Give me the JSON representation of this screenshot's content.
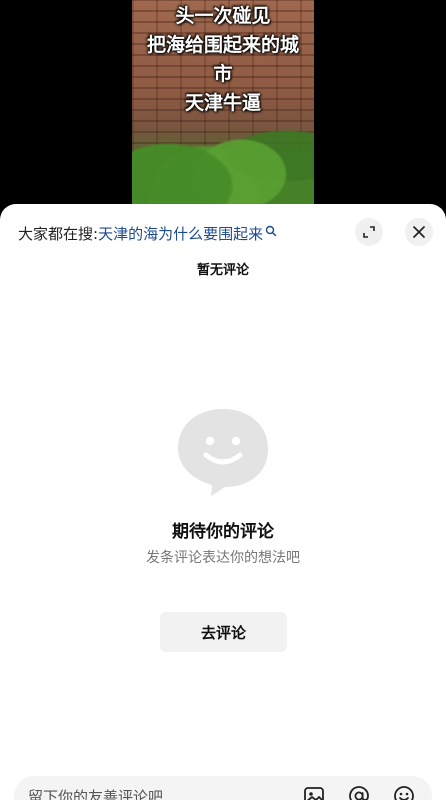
{
  "video": {
    "caption_lines": [
      "头一次碰见",
      "把海给围起来的城",
      "市",
      "天津牛逼"
    ]
  },
  "comments": {
    "search_prefix": "大家都在搜:",
    "search_query": "天津的海为什么要围起来",
    "title": "暂无评论",
    "empty_title": "期待你的评论",
    "empty_subtitle": "发条评论表达你的想法吧",
    "go_comment_label": "去评论",
    "input_placeholder": "留下你的友善评论吧"
  },
  "icons": {
    "search": "search-icon",
    "expand": "expand-icon",
    "close": "close-icon",
    "image": "image-icon",
    "at": "at-icon",
    "emoji": "emoji-icon",
    "empty_state": "smiley-bubble-icon"
  },
  "colors": {
    "search_query": "#1e4b8f",
    "sheet_background": "#ffffff",
    "illustration": "#e3e3e3"
  }
}
